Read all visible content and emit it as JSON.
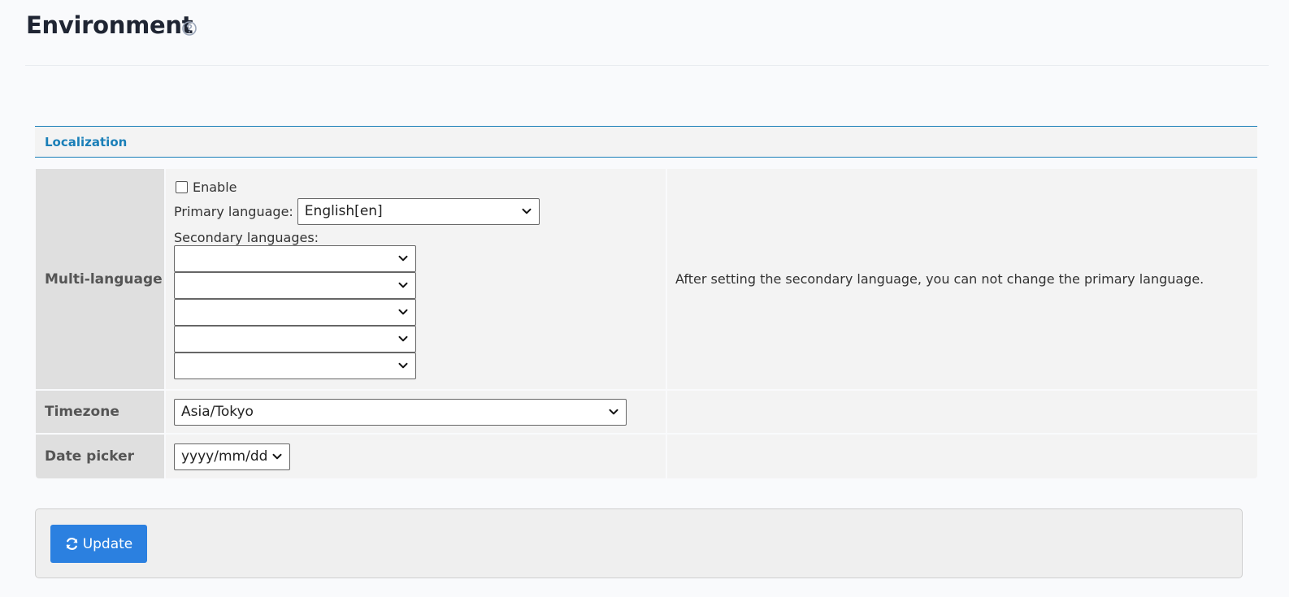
{
  "page": {
    "title": "Environment",
    "help_icon": "question-circle-icon"
  },
  "section": {
    "title": "Localization"
  },
  "multi_language": {
    "label": "Multi-language",
    "enable_label": "Enable",
    "enable_checked": false,
    "primary_label": "Primary language:",
    "primary_value": "English[en]",
    "secondary_label": "Secondary languages:",
    "secondary_values": [
      "",
      "",
      "",
      "",
      ""
    ],
    "note": "After setting the secondary language, you can not change the primary language."
  },
  "timezone": {
    "label": "Timezone",
    "value": "Asia/Tokyo"
  },
  "date_picker": {
    "label": "Date picker",
    "value": "yyyy/mm/dd"
  },
  "footer": {
    "update_label": "Update",
    "update_icon": "refresh-icon"
  },
  "colors": {
    "accent": "#1a7fb8",
    "button": "#2b80e0"
  }
}
